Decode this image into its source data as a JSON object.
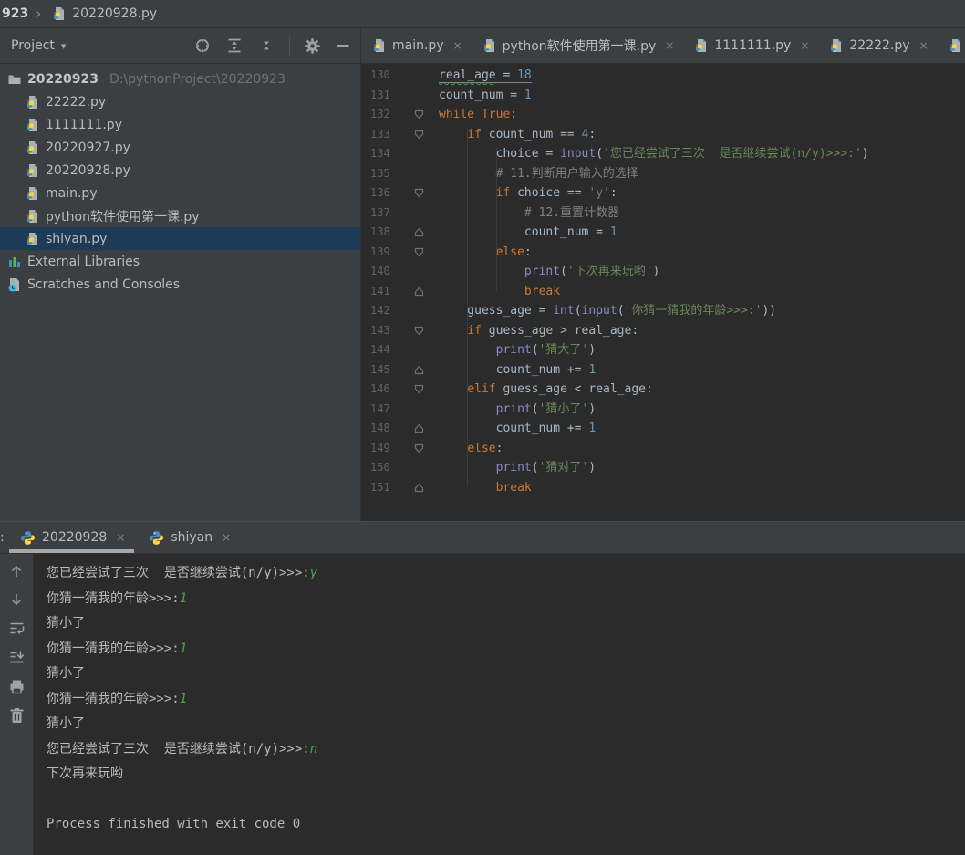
{
  "colors": {
    "panel_bg": "#3C3F41",
    "editor_bg": "#2B2B2B",
    "selection_bg": "#1D3B57",
    "keyword": "#CC7832",
    "string": "#6A8759",
    "number": "#6897BB",
    "builtin": "#8888C6",
    "comment": "#808080",
    "code_default": "#A9B7C6",
    "console_input_green": "#4EA24E",
    "active_tab_underline": "#A7A7A7"
  },
  "titlebar": {
    "breadcrumb_prefix": "923",
    "breadcrumb_chevron": "›",
    "breadcrumb_file": "20220928.py"
  },
  "project_panel": {
    "header_label": "Project",
    "header_icons": [
      "locate-icon",
      "expand-all-icon",
      "collapse-all-icon",
      "settings-gear-icon",
      "hide-panel-icon"
    ],
    "root": {
      "name": "20220923",
      "path": "D:\\pythonProject\\20220923"
    },
    "files": [
      "22222.py",
      "1111111.py",
      "20220927.py",
      "20220928.py",
      "main.py",
      "python软件使用第一课.py",
      "shiyan.py"
    ],
    "selected_file": "shiyan.py",
    "special_nodes": [
      "External Libraries",
      "Scratches and Consoles"
    ]
  },
  "editor": {
    "tabs": [
      {
        "label": "main.py",
        "close": "×"
      },
      {
        "label": "python软件使用第一课.py",
        "close": "×"
      },
      {
        "label": "1111111.py",
        "close": "×"
      },
      {
        "label": "22222.py",
        "close": "×"
      }
    ],
    "has_partial_tab": true,
    "lines": [
      {
        "no": 130,
        "fold": null,
        "tokens": [
          {
            "t": "real_age",
            "c": "t u wavy"
          },
          {
            "t": " = ",
            "c": "t u"
          },
          {
            "t": "18",
            "c": "n u"
          }
        ]
      },
      {
        "no": 131,
        "fold": null,
        "tokens": [
          {
            "t": "count_num = ",
            "c": "t"
          },
          {
            "t": "1",
            "c": "n"
          }
        ]
      },
      {
        "no": 132,
        "fold": "down",
        "tokens": [
          {
            "t": "while ",
            "c": "k"
          },
          {
            "t": "True",
            "c": "k"
          },
          {
            "t": ":",
            "c": "t"
          }
        ]
      },
      {
        "no": 133,
        "fold": "down",
        "tokens": [
          {
            "t": "    ",
            "c": "t"
          },
          {
            "t": "if ",
            "c": "k"
          },
          {
            "t": "count_num == ",
            "c": "t"
          },
          {
            "t": "4",
            "c": "n"
          },
          {
            "t": ":",
            "c": "t"
          }
        ]
      },
      {
        "no": 134,
        "fold": null,
        "tokens": [
          {
            "t": "        choice = ",
            "c": "t"
          },
          {
            "t": "input",
            "c": "f"
          },
          {
            "t": "(",
            "c": "t"
          },
          {
            "t": "'您已经尝试了三次  是否继续尝试(n/y)>>>:'",
            "c": "s"
          },
          {
            "t": ")",
            "c": "t"
          }
        ]
      },
      {
        "no": 135,
        "fold": null,
        "tokens": [
          {
            "t": "        # 11.判断用户输入的选择",
            "c": "c"
          }
        ]
      },
      {
        "no": 136,
        "fold": "down",
        "tokens": [
          {
            "t": "        ",
            "c": "t"
          },
          {
            "t": "if ",
            "c": "k"
          },
          {
            "t": "choice == ",
            "c": "t"
          },
          {
            "t": "'y'",
            "c": "s"
          },
          {
            "t": ":",
            "c": "t"
          }
        ]
      },
      {
        "no": 137,
        "fold": null,
        "tokens": [
          {
            "t": "            # 12.重置计数器",
            "c": "c"
          }
        ]
      },
      {
        "no": 138,
        "fold": "up",
        "tokens": [
          {
            "t": "            count_num = ",
            "c": "t"
          },
          {
            "t": "1",
            "c": "n"
          }
        ]
      },
      {
        "no": 139,
        "fold": "down",
        "tokens": [
          {
            "t": "        ",
            "c": "t"
          },
          {
            "t": "else",
            "c": "k"
          },
          {
            "t": ":",
            "c": "t"
          }
        ]
      },
      {
        "no": 140,
        "fold": null,
        "tokens": [
          {
            "t": "            ",
            "c": "t"
          },
          {
            "t": "print",
            "c": "f"
          },
          {
            "t": "(",
            "c": "t"
          },
          {
            "t": "'下次再来玩哟'",
            "c": "s"
          },
          {
            "t": ")",
            "c": "t"
          }
        ]
      },
      {
        "no": 141,
        "fold": "up",
        "tokens": [
          {
            "t": "            ",
            "c": "t"
          },
          {
            "t": "break",
            "c": "k"
          }
        ]
      },
      {
        "no": 142,
        "fold": null,
        "tokens": [
          {
            "t": "    guess_age = ",
            "c": "t"
          },
          {
            "t": "int",
            "c": "f"
          },
          {
            "t": "(",
            "c": "t"
          },
          {
            "t": "input",
            "c": "f"
          },
          {
            "t": "(",
            "c": "t"
          },
          {
            "t": "'你猜一猜我的年龄>>>:'",
            "c": "s"
          },
          {
            "t": "))",
            "c": "t"
          }
        ]
      },
      {
        "no": 143,
        "fold": "down",
        "tokens": [
          {
            "t": "    ",
            "c": "t"
          },
          {
            "t": "if ",
            "c": "k"
          },
          {
            "t": "guess_age > real_age:",
            "c": "t"
          }
        ]
      },
      {
        "no": 144,
        "fold": null,
        "tokens": [
          {
            "t": "        ",
            "c": "t"
          },
          {
            "t": "print",
            "c": "f"
          },
          {
            "t": "(",
            "c": "t"
          },
          {
            "t": "'猜大了'",
            "c": "s"
          },
          {
            "t": ")",
            "c": "t"
          }
        ]
      },
      {
        "no": 145,
        "fold": "up",
        "tokens": [
          {
            "t": "        count_num += ",
            "c": "t"
          },
          {
            "t": "1",
            "c": "n"
          }
        ]
      },
      {
        "no": 146,
        "fold": "down",
        "tokens": [
          {
            "t": "    ",
            "c": "t"
          },
          {
            "t": "elif ",
            "c": "k"
          },
          {
            "t": "guess_age < real_age:",
            "c": "t"
          }
        ]
      },
      {
        "no": 147,
        "fold": null,
        "tokens": [
          {
            "t": "        ",
            "c": "t"
          },
          {
            "t": "print",
            "c": "f"
          },
          {
            "t": "(",
            "c": "t"
          },
          {
            "t": "'猜小了'",
            "c": "s"
          },
          {
            "t": ")",
            "c": "t"
          }
        ]
      },
      {
        "no": 148,
        "fold": "up",
        "tokens": [
          {
            "t": "        count_num += ",
            "c": "t"
          },
          {
            "t": "1",
            "c": "n"
          }
        ]
      },
      {
        "no": 149,
        "fold": "down",
        "tokens": [
          {
            "t": "    ",
            "c": "t"
          },
          {
            "t": "else",
            "c": "k"
          },
          {
            "t": ":",
            "c": "t"
          }
        ]
      },
      {
        "no": 150,
        "fold": null,
        "tokens": [
          {
            "t": "        ",
            "c": "t"
          },
          {
            "t": "print",
            "c": "f"
          },
          {
            "t": "(",
            "c": "t"
          },
          {
            "t": "'猜对了'",
            "c": "s"
          },
          {
            "t": ")",
            "c": "t"
          }
        ]
      },
      {
        "no": 151,
        "fold": "up",
        "tokens": [
          {
            "t": "        ",
            "c": "t"
          },
          {
            "t": "break",
            "c": "k"
          }
        ]
      }
    ]
  },
  "console": {
    "run_label_fragment": ":",
    "tabs": [
      {
        "label": "20220928",
        "close": "×",
        "active": true
      },
      {
        "label": "shiyan",
        "close": "×",
        "active": false
      }
    ],
    "toolbar_icons": [
      "up-arrow-icon",
      "down-arrow-icon",
      "soft-wrap-icon",
      "scroll-to-end-icon",
      "print-icon",
      "clear-all-icon"
    ],
    "lines": [
      {
        "text": "您已经尝试了三次  是否继续尝试(n/y)>>>:",
        "input": "y"
      },
      {
        "text": "你猜一猜我的年龄>>>:",
        "input": "1"
      },
      {
        "text": "猜小了",
        "input": null
      },
      {
        "text": "你猜一猜我的年龄>>>:",
        "input": "1"
      },
      {
        "text": "猜小了",
        "input": null
      },
      {
        "text": "你猜一猜我的年龄>>>:",
        "input": "1"
      },
      {
        "text": "猜小了",
        "input": null
      },
      {
        "text": "您已经尝试了三次  是否继续尝试(n/y)>>>:",
        "input": "n"
      },
      {
        "text": "下次再来玩哟",
        "input": null
      },
      {
        "text": "",
        "input": null
      },
      {
        "text": "Process finished with exit code 0",
        "input": null
      }
    ]
  }
}
